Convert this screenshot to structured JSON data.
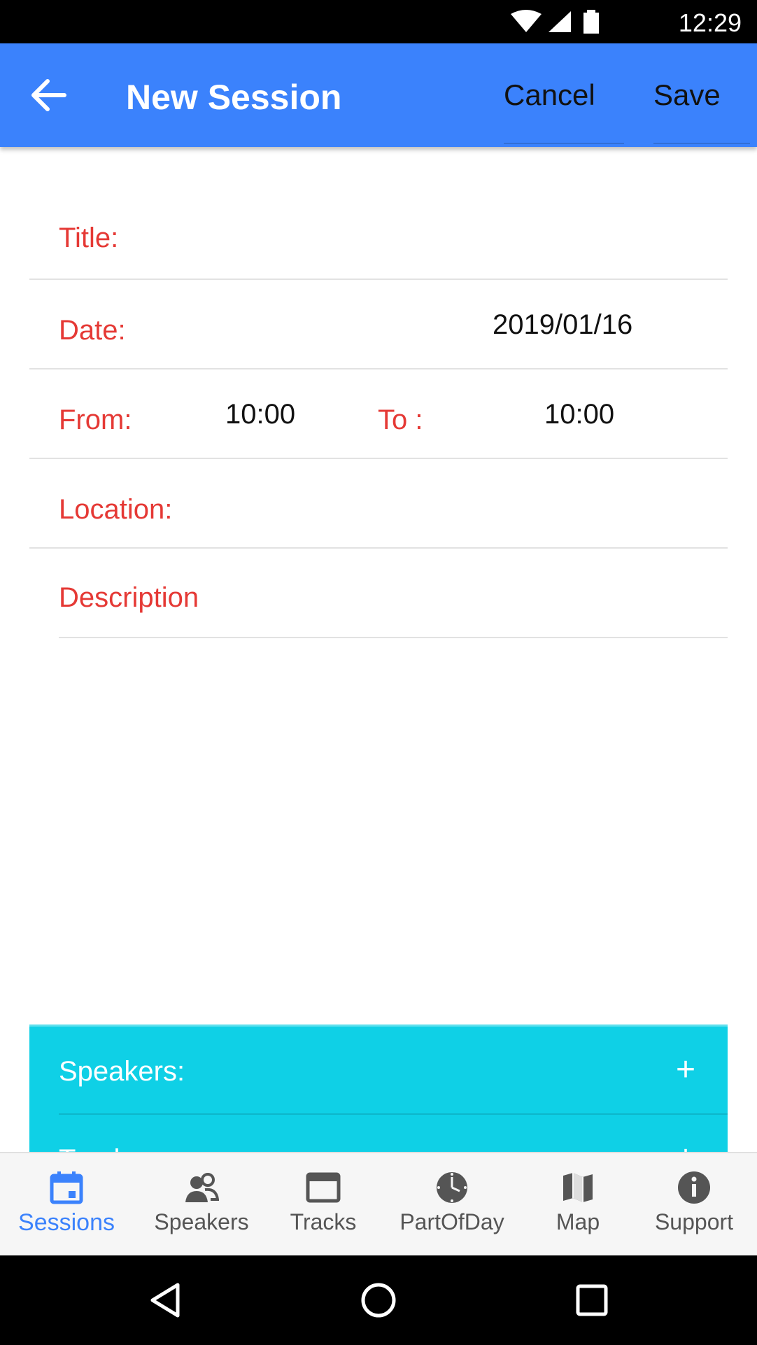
{
  "status_bar": {
    "time": "12:29"
  },
  "app_bar": {
    "title": "New Session",
    "cancel_label": "Cancel",
    "save_label": "Save"
  },
  "form": {
    "title_label": "Title:",
    "title_value": "",
    "date_label": "Date:",
    "date_value": "2019/01/16",
    "from_label": "From:",
    "from_value": "10:00",
    "to_label": "To :",
    "to_value": "10:00",
    "location_label": "Location:",
    "description_label": "Description"
  },
  "accordion": {
    "speakers_label": "Speakers:",
    "tracks_label": "Tracks:",
    "add_symbol": "+"
  },
  "tabs": [
    {
      "label": "Sessions",
      "icon": "calendar-icon",
      "active": true
    },
    {
      "label": "Speakers",
      "icon": "people-icon",
      "active": false
    },
    {
      "label": "Tracks",
      "icon": "window-icon",
      "active": false
    },
    {
      "label": "PartOfDay",
      "icon": "clock-icon",
      "active": false
    },
    {
      "label": "Map",
      "icon": "map-icon",
      "active": false
    },
    {
      "label": "Support",
      "icon": "info-icon",
      "active": false
    }
  ],
  "colors": {
    "app_bar": "#3b82fc",
    "label_red": "#e53935",
    "accordion": "#0fd0e6",
    "tab_active": "#3b82fc",
    "tab_inactive": "#555555"
  }
}
